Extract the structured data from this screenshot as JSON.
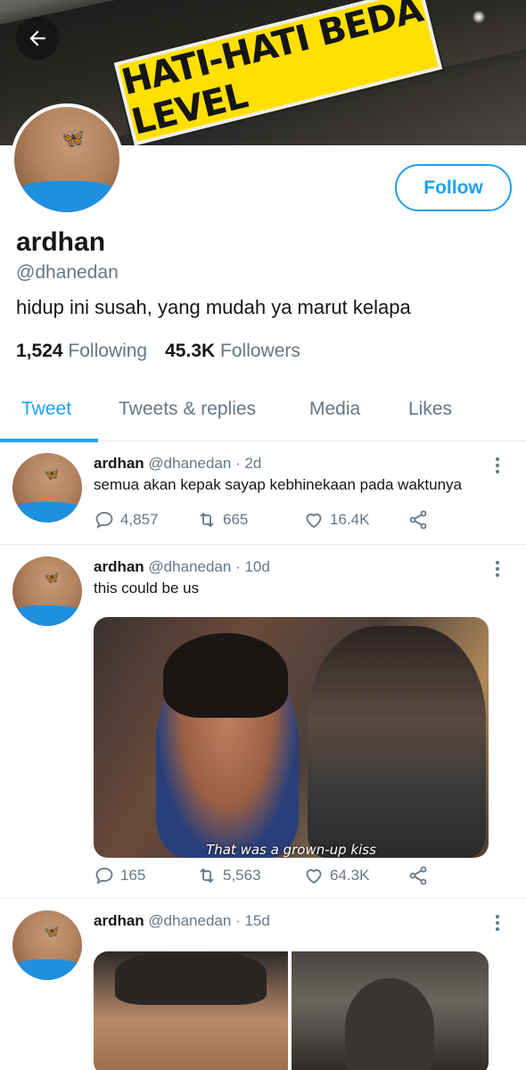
{
  "header": {
    "banner_text": "HATI-HATI  BEDA LEVEL",
    "back_icon": "arrow-left-icon"
  },
  "profile": {
    "name": "ardhan",
    "handle": "@dhanedan",
    "bio": "hidup ini susah, yang mudah ya marut kelapa",
    "follow_label": "Follow",
    "following_count": "1,524",
    "following_label": "Following",
    "followers_count": "45.3K",
    "followers_label": "Followers"
  },
  "tabs": [
    {
      "label": "Tweet",
      "active": true
    },
    {
      "label": "Tweets & replies",
      "active": false
    },
    {
      "label": "Media",
      "active": false
    },
    {
      "label": "Likes",
      "active": false
    }
  ],
  "tweets": [
    {
      "name": "ardhan",
      "handle": "@dhanedan",
      "sep": "·",
      "time": "2d",
      "text": "semua akan kepak sayap kebhinekaan pada waktunya",
      "replies": "4,857",
      "retweets": "665",
      "likes": "16.4K"
    },
    {
      "name": "ardhan",
      "handle": "@dhanedan",
      "sep": "·",
      "time": "10d",
      "text": "this could be us",
      "media_caption": "That was a grown-up kiss",
      "replies": "165",
      "retweets": "5,563",
      "likes": "64.3K"
    },
    {
      "name": "ardhan",
      "handle": "@dhanedan",
      "sep": "·",
      "time": "15d"
    }
  ],
  "colors": {
    "accent": "#1da1f2",
    "muted": "#657786",
    "text": "#14171a"
  }
}
